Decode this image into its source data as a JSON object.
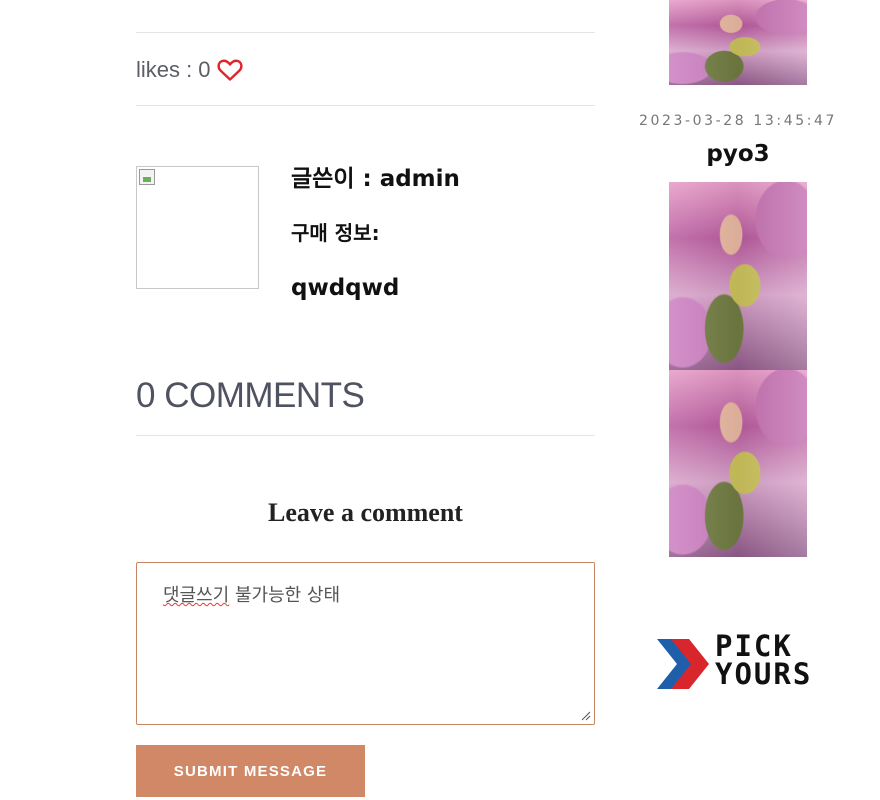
{
  "post": {
    "likes_label": "likes :",
    "likes_count": "0",
    "author_label": "글쓴이 : admin",
    "purchase_label": "구매 정보:",
    "purchase_value": "qwdqwd"
  },
  "comments": {
    "title": "0 COMMENTS",
    "leave_title": "Leave a comment",
    "textarea_underlined": "댓글쓰기",
    "textarea_rest": " 불가능한 상태",
    "submit_label": "SUBMIT MESSAGE"
  },
  "sidebar": {
    "date": "2023-03-28 13:45:47",
    "user": "pyo3",
    "logo_line1": "PICK",
    "logo_line2": "YOURS"
  },
  "colors": {
    "accent": "#d08866",
    "heart": "#e0242b",
    "logo_blue": "#1f5ea8",
    "logo_red": "#d8262c"
  }
}
